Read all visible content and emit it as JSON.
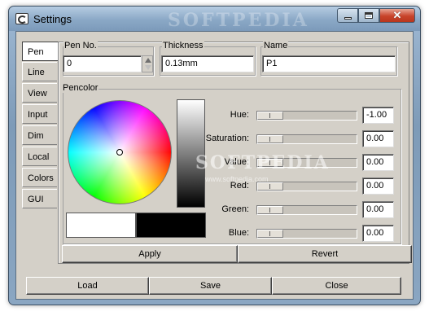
{
  "window": {
    "title": "Settings",
    "watermark": "SOFTPEDIA",
    "watermark_sub": "www.softpedia.com"
  },
  "tabs": [
    "Pen",
    "Line",
    "View",
    "Input",
    "Dim",
    "Local",
    "Colors",
    "GUI"
  ],
  "active_tab": "Pen",
  "pen": {
    "pen_no_label": "Pen No.",
    "pen_no_value": "0",
    "thickness_label": "Thickness",
    "thickness_value": "0.13mm",
    "name_label": "Name",
    "name_value": "P1"
  },
  "pencolor": {
    "group_label": "Pencolor",
    "swatch_left_color": "#ffffff",
    "swatch_right_color": "#000000",
    "sliders": [
      {
        "label": "Hue:",
        "value": "-1.00"
      },
      {
        "label": "Saturation:",
        "value": "0.00"
      },
      {
        "label": "Value:",
        "value": "0.00"
      },
      {
        "label": "Red:",
        "value": "0.00"
      },
      {
        "label": "Green:",
        "value": "0.00"
      },
      {
        "label": "Blue:",
        "value": "0.00"
      }
    ]
  },
  "panel_buttons": {
    "apply": "Apply",
    "revert": "Revert"
  },
  "footer_buttons": {
    "load": "Load",
    "save": "Save",
    "close": "Close"
  }
}
